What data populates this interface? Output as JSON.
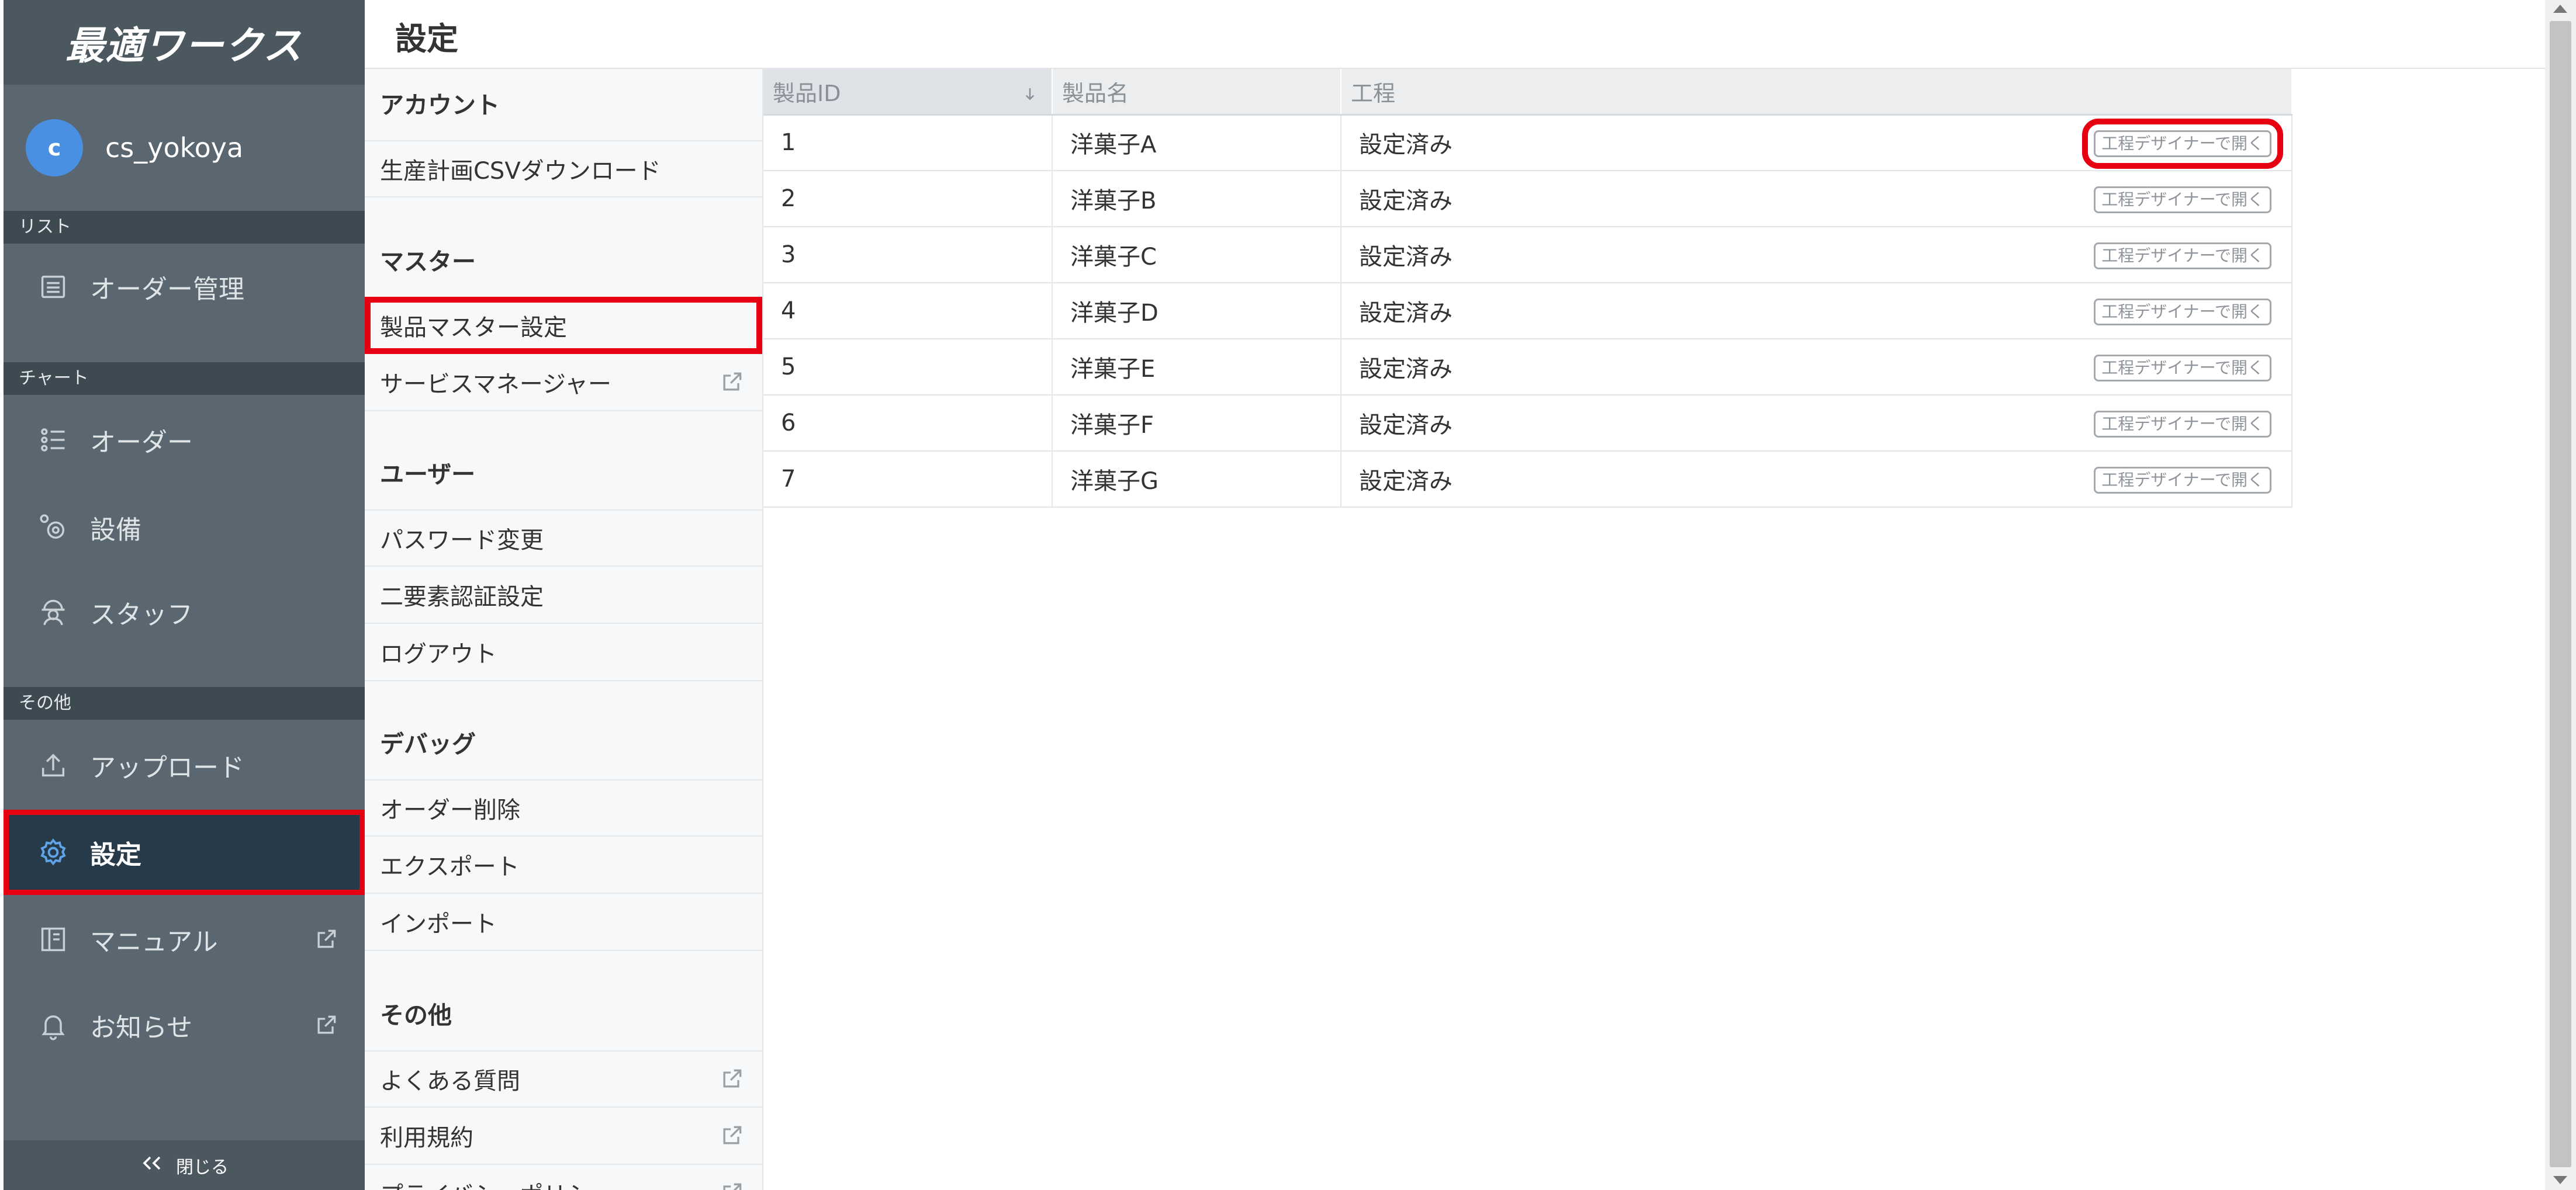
{
  "app": {
    "logo_text": "最適ワークス"
  },
  "user": {
    "avatar_initial": "c",
    "name": "cs_yokoya"
  },
  "sidebar": {
    "sections": [
      {
        "label": "リスト"
      },
      {
        "label": "チャート"
      },
      {
        "label": "その他"
      }
    ],
    "items": [
      {
        "label": "オーダー管理",
        "icon": "list-icon"
      },
      {
        "label": "オーダー",
        "icon": "bullet-list-icon"
      },
      {
        "label": "設備",
        "icon": "gears-icon"
      },
      {
        "label": "スタッフ",
        "icon": "staff-icon"
      },
      {
        "label": "アップロード",
        "icon": "upload-icon"
      },
      {
        "label": "設定",
        "icon": "gear-icon",
        "active": true,
        "highlighted": true
      },
      {
        "label": "マニュアル",
        "icon": "book-icon",
        "external": true
      },
      {
        "label": "お知らせ",
        "icon": "bell-icon",
        "external": true
      }
    ],
    "collapse_label": "閉じる",
    "collapse_icon": "double-chevron-left-icon"
  },
  "header": {
    "title": "設定"
  },
  "settings_menu": {
    "sections": [
      {
        "title": "アカウント",
        "items": [
          {
            "label": "生産計画CSVダウンロード"
          }
        ]
      },
      {
        "title": "マスター",
        "items": [
          {
            "label": "製品マスター設定",
            "highlighted": true
          },
          {
            "label": "サービスマネージャー",
            "external": true
          }
        ]
      },
      {
        "title": "ユーザー",
        "items": [
          {
            "label": "パスワード変更"
          },
          {
            "label": "二要素認証設定"
          },
          {
            "label": "ログアウト"
          }
        ]
      },
      {
        "title": "デバッグ",
        "items": [
          {
            "label": "オーダー削除"
          },
          {
            "label": "エクスポート"
          },
          {
            "label": "インポート"
          }
        ]
      },
      {
        "title": "その他",
        "items": [
          {
            "label": "よくある質問",
            "external": true
          },
          {
            "label": "利用規約",
            "external": true
          },
          {
            "label": "プライバシーポリシー",
            "external": true
          }
        ]
      }
    ]
  },
  "table": {
    "columns": [
      "製品ID",
      "製品名",
      "工程"
    ],
    "sort": {
      "column": "製品ID",
      "direction": "desc"
    },
    "action_label": "工程デザイナーで開く",
    "rows": [
      {
        "id": "1",
        "name": "洋菓子A",
        "process": "設定済み",
        "highlighted": true
      },
      {
        "id": "2",
        "name": "洋菓子B",
        "process": "設定済み"
      },
      {
        "id": "3",
        "name": "洋菓子C",
        "process": "設定済み"
      },
      {
        "id": "4",
        "name": "洋菓子D",
        "process": "設定済み"
      },
      {
        "id": "5",
        "name": "洋菓子E",
        "process": "設定済み"
      },
      {
        "id": "6",
        "name": "洋菓子F",
        "process": "設定済み"
      },
      {
        "id": "7",
        "name": "洋菓子G",
        "process": "設定済み"
      }
    ]
  },
  "colors": {
    "sidebar_bg": "#5b6770",
    "sidebar_section_bg": "#3e4a52",
    "sidebar_active_bg": "#263a4a",
    "avatar": "#4a90e2",
    "highlight": "#e60012"
  }
}
